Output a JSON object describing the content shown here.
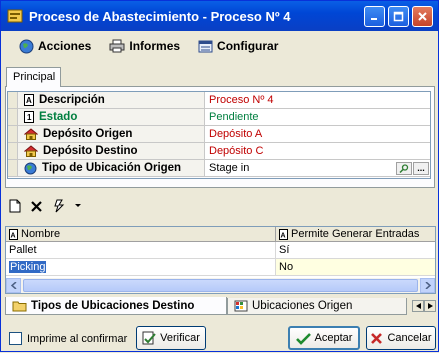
{
  "window": {
    "title": "Proceso de Abastecimiento - Proceso Nº 4"
  },
  "menu": {
    "acciones": "Acciones",
    "informes": "Informes",
    "configurar": "Configurar"
  },
  "tab_principal": "Principal",
  "props": [
    {
      "label": "Descripción",
      "value": "Proceso Nº 4",
      "value_color": "#C00000",
      "label_color": "#000000"
    },
    {
      "label": "Estado",
      "value": "Pendiente",
      "value_color": "#007F3F",
      "label_color": "#007F3F"
    },
    {
      "label": "Depósito Origen",
      "value": "Depósito A",
      "value_color": "#C00000",
      "label_color": "#000000"
    },
    {
      "label": "Depósito Destino",
      "value": "Depósito C",
      "value_color": "#C00000",
      "label_color": "#000000"
    },
    {
      "label": "Tipo de Ubicación Origen",
      "value": "Stage in",
      "value_color": "#000000",
      "label_color": "#000000"
    }
  ],
  "browse_label": "...",
  "grid": {
    "columns": [
      "Nombre",
      "Permite Generar Entradas"
    ],
    "rows": [
      [
        "Pallet",
        "Sí"
      ],
      [
        "Picking",
        "No"
      ]
    ]
  },
  "bottom_tabs": [
    "Tipos de Ubicaciones Destino",
    "Ubicaciones Origen"
  ],
  "footer": {
    "checkbox_label": "Imprime al confirmar",
    "verificar": "Verificar",
    "aceptar": "Aceptar",
    "cancelar": "Cancelar"
  }
}
